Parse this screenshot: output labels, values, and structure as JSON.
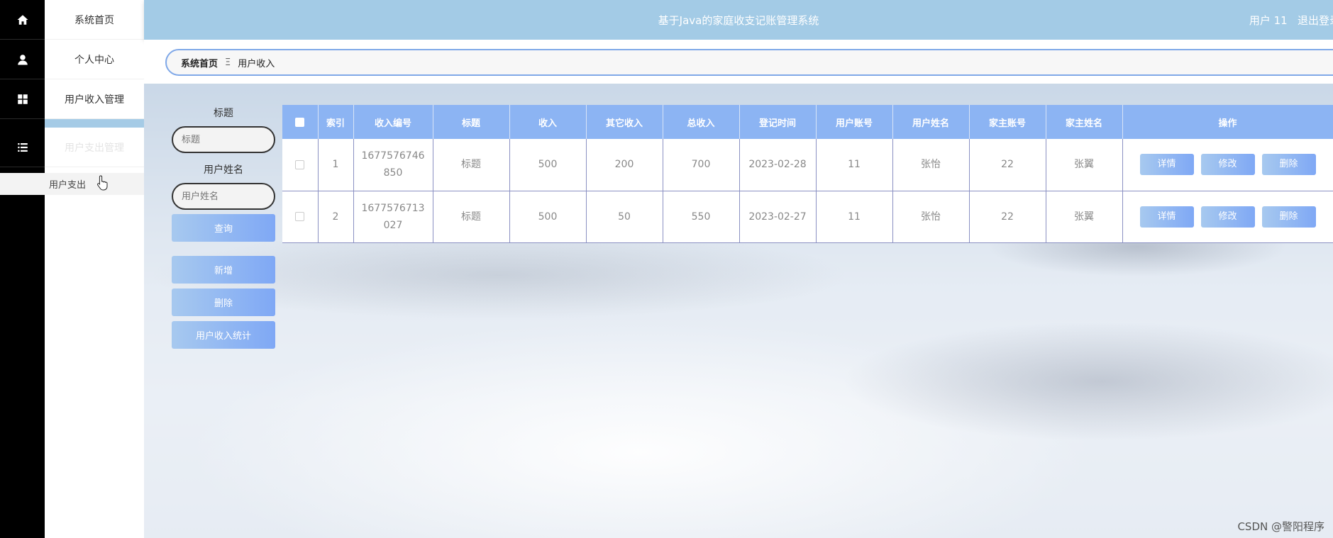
{
  "header": {
    "title": "基于Java的家庭收支记账管理系统",
    "user": "用户 11",
    "logout": "退出登录"
  },
  "menu": {
    "items": [
      {
        "label": "系统首页",
        "icon": "home-icon"
      },
      {
        "label": "个人中心",
        "icon": "user-icon"
      },
      {
        "label": "用户收入管理",
        "icon": "grid-icon"
      },
      {
        "label": "用户支出管理",
        "icon": "list-icon"
      }
    ],
    "submenu_item": "用户支出"
  },
  "breadcrumb": {
    "home": "系统首页",
    "separator": "Ξ",
    "current": "用户收入"
  },
  "search": {
    "title_label": "标题",
    "title_placeholder": "标题",
    "name_label": "用户姓名",
    "name_placeholder": "用户姓名",
    "query_button": "查询",
    "add_button": "新增",
    "delete_button": "删除",
    "stats_button": "用户收入统计"
  },
  "table": {
    "columns": [
      "索引",
      "收入编号",
      "标题",
      "收入",
      "其它收入",
      "总收入",
      "登记时间",
      "用户账号",
      "用户姓名",
      "家主账号",
      "家主姓名",
      "操作"
    ],
    "rows": [
      {
        "index": "1",
        "code": "1677576746850",
        "title": "标题",
        "income": "500",
        "other": "200",
        "total": "700",
        "date": "2023-02-28",
        "account": "11",
        "name": "张怡",
        "owner_account": "22",
        "owner_name": "张翼"
      },
      {
        "index": "2",
        "code": "1677576713027",
        "title": "标题",
        "income": "500",
        "other": "50",
        "total": "550",
        "date": "2023-02-27",
        "account": "11",
        "name": "张怡",
        "owner_account": "22",
        "owner_name": "张翼"
      }
    ],
    "actions": {
      "detail": "详情",
      "edit": "修改",
      "delete": "删除"
    }
  },
  "watermark": "CSDN @警阳程序"
}
